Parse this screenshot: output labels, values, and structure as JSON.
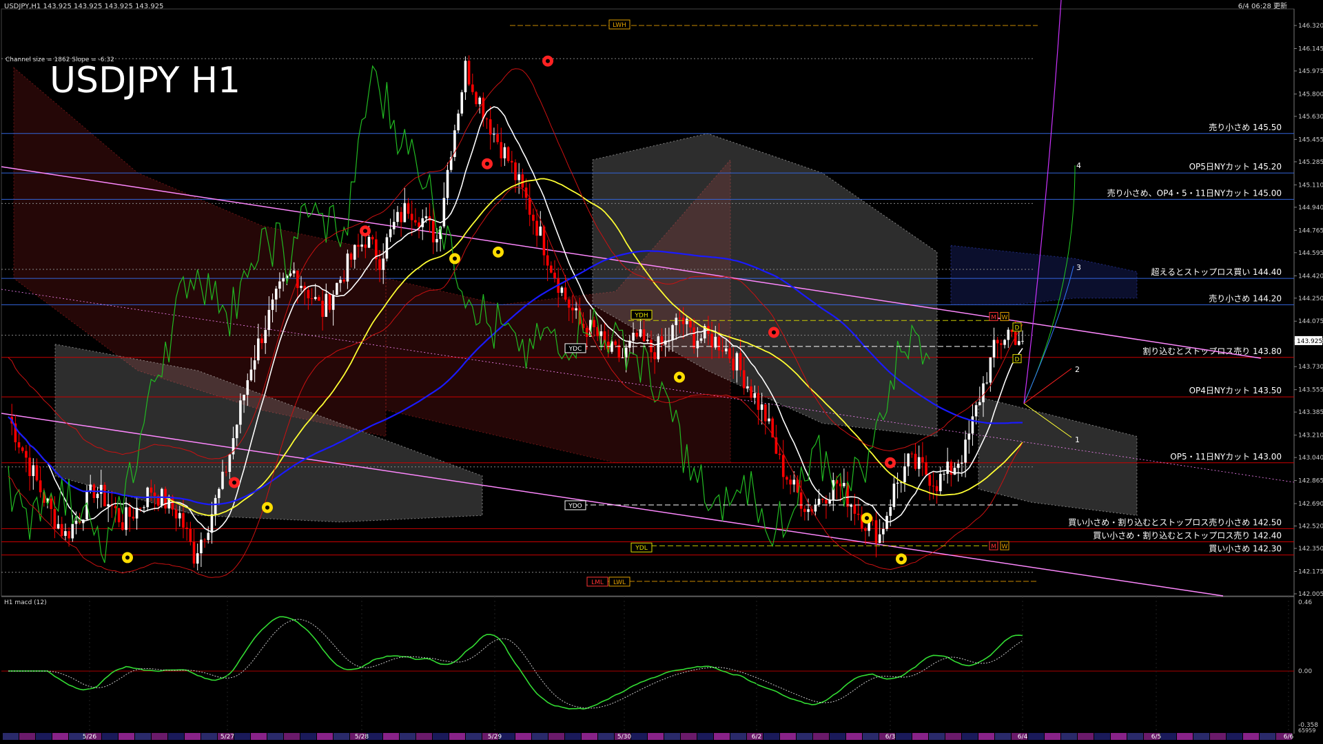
{
  "header": {
    "symbol_info": "USDJPY,H1  143.925 143.925 143.925 143.925",
    "datetime": "6/4 06:28 更新",
    "channel_info": "Channel size = 1862 Slope = -6.32",
    "big_title": "USDJPY H1"
  },
  "colors": {
    "background": "#000000",
    "bull_candle": "#ffffff",
    "bear_candle": "#ff0000",
    "ma_white": "#ffffff",
    "ma_yellow": "#ffff33",
    "ma_blue": "#1a1aff",
    "channel": "#ff88ff",
    "chikou": "#22bb22",
    "support_line": "#cc0000",
    "resistance_line": "#3366dd",
    "cloud_red": "#aa2222",
    "cloud_white": "#cccccc",
    "cloud_blue": "#3344cc",
    "price_box": "#ffffff",
    "macd_main": "#33dd33",
    "macd_signal": "#cccccc"
  },
  "chart_data": [
    {
      "type": "candlestick",
      "title": "USDJPY H1",
      "ylim": [
        142.005,
        146.4
      ],
      "y_ticks": [
        "146.320",
        "146.145",
        "145.975",
        "145.800",
        "145.630",
        "145.455",
        "145.285",
        "145.110",
        "144.940",
        "144.765",
        "144.595",
        "144.420",
        "144.250",
        "144.075",
        "143.925",
        "143.730",
        "143.555",
        "143.385",
        "143.210",
        "143.040",
        "142.865",
        "142.690",
        "142.520",
        "142.350",
        "142.175",
        "142.005"
      ],
      "current_price": "143.925",
      "x_labels": [
        "5/26",
        "5/27",
        "5/28",
        "5/29",
        "5/30",
        "6/2",
        "6/3",
        "6/4",
        "6/5",
        "6/6"
      ],
      "close_path": [
        143.35,
        143.1,
        142.85,
        142.62,
        142.45,
        142.6,
        142.8,
        142.7,
        142.55,
        142.65,
        142.8,
        142.7,
        142.6,
        142.3,
        142.55,
        142.85,
        143.3,
        143.75,
        144.05,
        144.3,
        144.45,
        144.3,
        144.15,
        144.35,
        144.55,
        144.7,
        144.55,
        144.8,
        144.95,
        144.85,
        144.7,
        145.4,
        146.0,
        145.75,
        145.5,
        145.3,
        145.05,
        144.8,
        144.5,
        144.25,
        144.05,
        144.0,
        143.85,
        143.8,
        143.95,
        143.85,
        143.9,
        144.1,
        143.95,
        143.95,
        143.9,
        143.75,
        143.55,
        143.35,
        143.0,
        142.8,
        142.65,
        142.75,
        142.85,
        142.7,
        142.55,
        142.45,
        142.8,
        143.0,
        142.95,
        142.85,
        142.95,
        143.1,
        143.5,
        143.85,
        144.0,
        143.925
      ],
      "resistance_levels": [
        {
          "label": "売り小さめ 145.50",
          "price": 145.5
        },
        {
          "label": "OP5日NYカット 145.20",
          "price": 145.2
        },
        {
          "label": "売り小さめ、OP4・5・11日NYカット 145.00",
          "price": 145.0
        },
        {
          "label": "超えるとストップロス買い 144.40",
          "price": 144.4
        },
        {
          "label": "売り小さめ 144.20",
          "price": 144.2
        }
      ],
      "support_levels": [
        {
          "label": "割り込むとストップロス売り 143.80",
          "price": 143.8
        },
        {
          "label": "OP4日NYカット 143.50",
          "price": 143.5
        },
        {
          "label": "OP5・11日NYカット 143.00",
          "price": 143.0
        },
        {
          "label": "買い小さめ・割り込むとストップロス売り小さめ 142.50",
          "price": 142.5
        },
        {
          "label": "買い小さめ・割り込むとストップロス売り 142.40",
          "price": 142.4
        },
        {
          "label": "買い小さめ 142.30",
          "price": 142.3
        }
      ],
      "markers": {
        "lwh": "LWH",
        "ydh": "YDH",
        "ydc": "YDC",
        "ydo": "YDO",
        "ydl": "YDL",
        "lml": "LML",
        "lwl": "LWL",
        "box_m": "M",
        "box_w": "W",
        "box_d": "D"
      },
      "scenario_labels": [
        "4",
        "3",
        "2",
        "1"
      ]
    },
    {
      "type": "line",
      "title": "H1  macd (12)",
      "ylim": [
        -0.358,
        0.46
      ],
      "y_ticks": [
        "0.46",
        "0.00",
        "-0.358"
      ],
      "extra_tick": "65959"
    }
  ]
}
